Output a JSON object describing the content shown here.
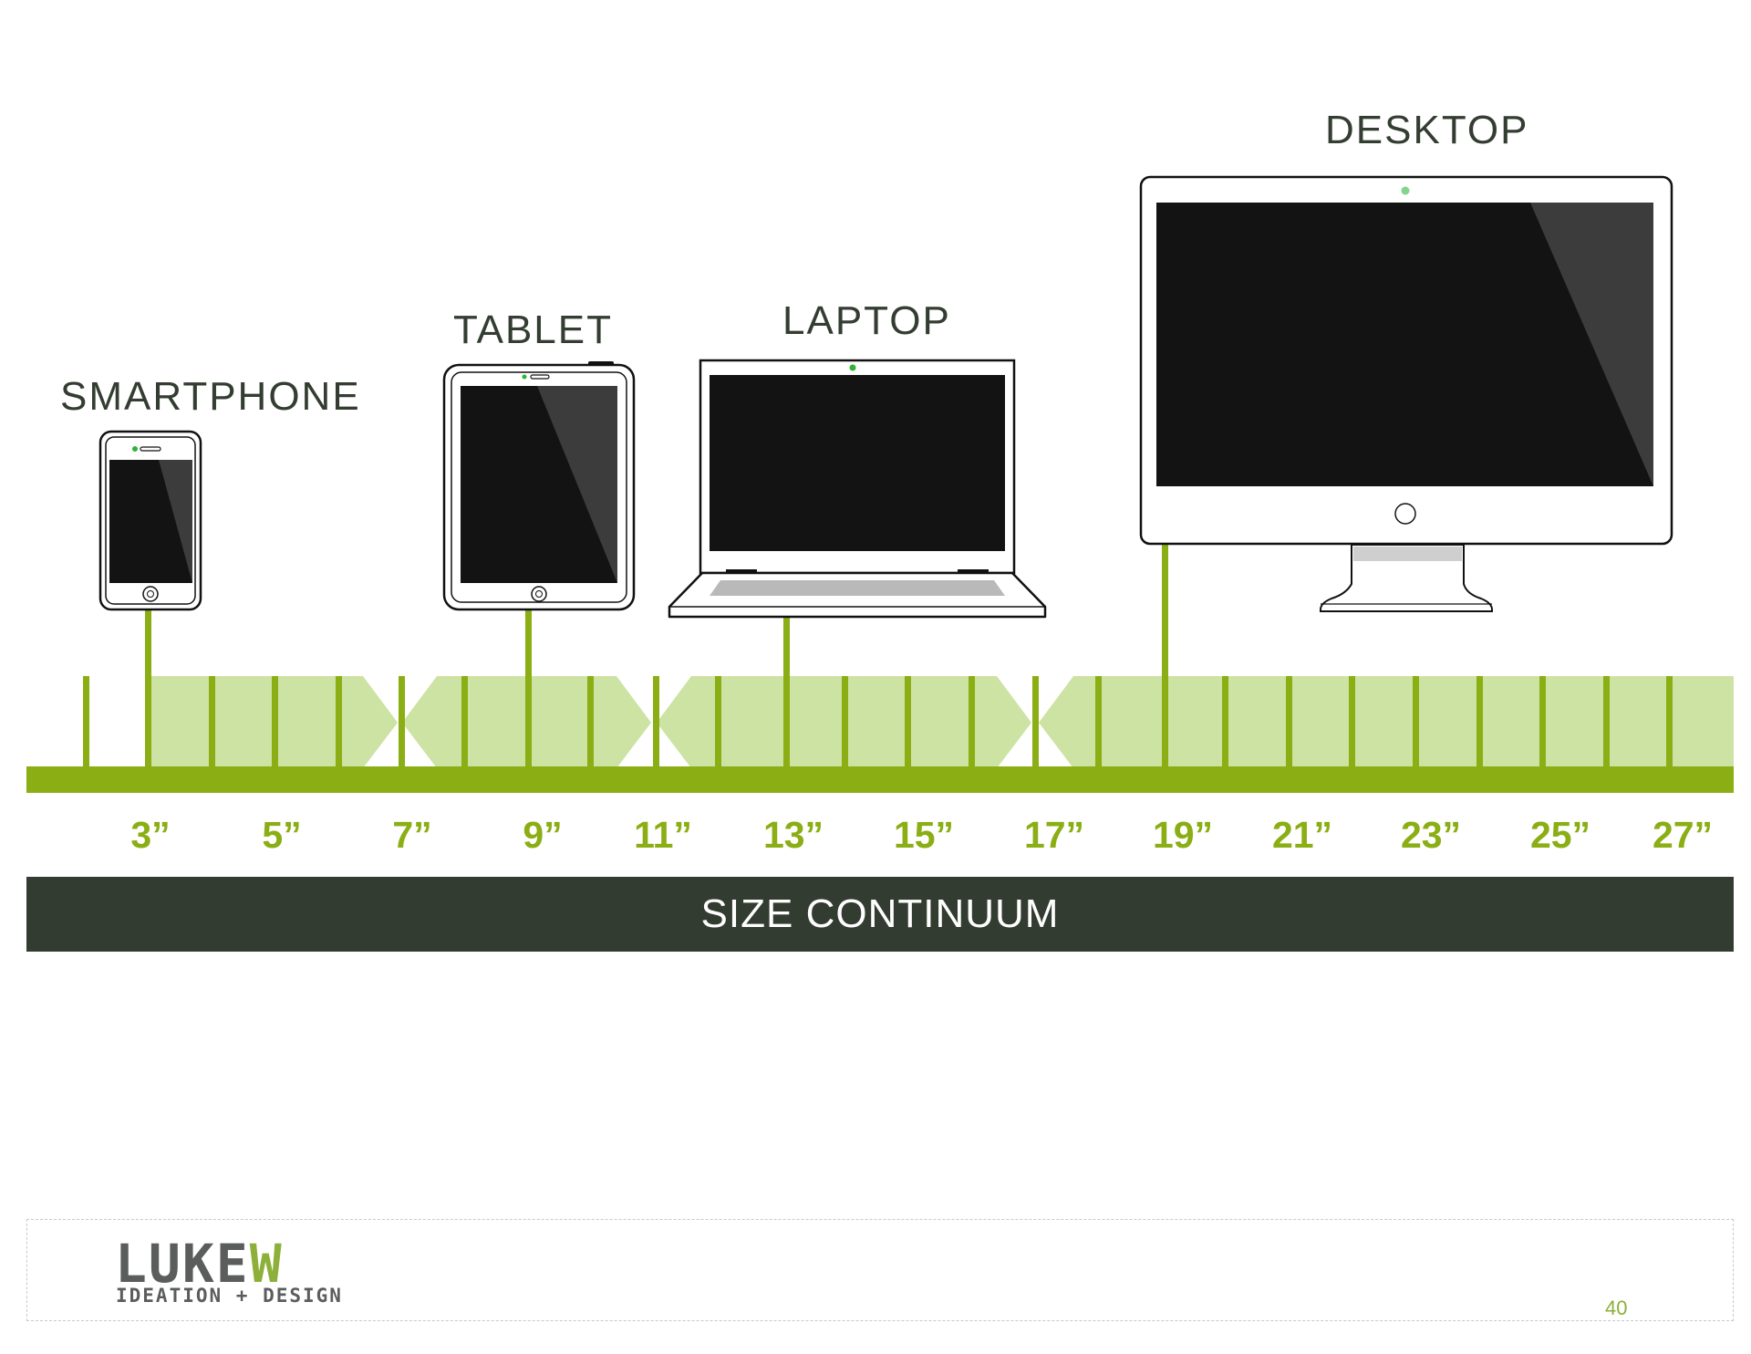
{
  "devices": {
    "smartphone": {
      "label": "SMARTPHONE"
    },
    "tablet": {
      "label": "TABLET"
    },
    "laptop": {
      "label": "LAPTOP"
    },
    "desktop": {
      "label": "DESKTOP"
    }
  },
  "continuum": {
    "size_labels": [
      "3”",
      "5”",
      "7”",
      "9”",
      "11”",
      "13”",
      "15”",
      "17”",
      "19”",
      "21”",
      "23”",
      "25”",
      "27”"
    ],
    "banner": "SIZE CONTINUUM"
  },
  "footer": {
    "logo_dark": "LUKE",
    "logo_green": "W",
    "tagline": "IDEATION + DESIGN",
    "page_number": "40"
  },
  "colors": {
    "accent_green": "#8aae14",
    "band_green": "#cde3a4",
    "dark_banner": "#333c30",
    "screen": "#131313",
    "led": "#2db336"
  }
}
